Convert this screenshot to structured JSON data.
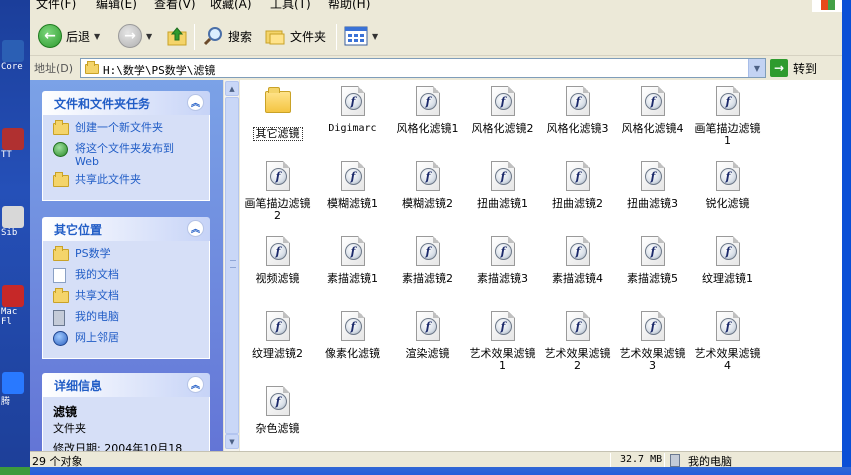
{
  "desktop": {
    "icons": [
      {
        "label": "Core"
      },
      {
        "label": "TT"
      },
      {
        "label": "Sib"
      },
      {
        "label": "Mac"
      },
      {
        "label": "Fl"
      },
      {
        "label": "腾"
      }
    ]
  },
  "menubar": {
    "items": [
      "文件(F)",
      "编辑(E)",
      "查看(V)",
      "收藏(A)",
      "工具(T)",
      "帮助(H)"
    ]
  },
  "toolbar": {
    "back_label": "后退",
    "search_label": "搜索",
    "folders_label": "文件夹"
  },
  "address": {
    "label": "地址(D)",
    "path": "H:\\数学\\PS数学\\滤镜",
    "go_label": "转到"
  },
  "taskpane": {
    "file_tasks": {
      "title": "文件和文件夹任务",
      "items": [
        "创建一个新文件夹",
        "将这个文件夹发布到 Web",
        "共享此文件夹"
      ]
    },
    "other_places": {
      "title": "其它位置",
      "items": [
        "PS数学",
        "我的文档",
        "共享文档",
        "我的电脑",
        "网上邻居"
      ]
    },
    "details": {
      "title": "详细信息",
      "name": "滤镜",
      "type": "文件夹",
      "modified": "修改日期: 2004年10月18"
    }
  },
  "files": [
    {
      "name": "其它滤镜",
      "type": "folder"
    },
    {
      "name": "Digimarc",
      "type": "swf"
    },
    {
      "name": "风格化滤镜1",
      "type": "swf"
    },
    {
      "name": "风格化滤镜2",
      "type": "swf"
    },
    {
      "name": "风格化滤镜3",
      "type": "swf"
    },
    {
      "name": "风格化滤镜4",
      "type": "swf"
    },
    {
      "name": "画笔描边滤镜1",
      "type": "swf"
    },
    {
      "name": "画笔描边滤镜2",
      "type": "swf"
    },
    {
      "name": "模糊滤镜1",
      "type": "swf"
    },
    {
      "name": "模糊滤镜2",
      "type": "swf"
    },
    {
      "name": "扭曲滤镜1",
      "type": "swf"
    },
    {
      "name": "扭曲滤镜2",
      "type": "swf"
    },
    {
      "name": "扭曲滤镜3",
      "type": "swf"
    },
    {
      "name": "锐化滤镜",
      "type": "swf"
    },
    {
      "name": "视频滤镜",
      "type": "swf"
    },
    {
      "name": "素描滤镜1",
      "type": "swf"
    },
    {
      "name": "素描滤镜2",
      "type": "swf"
    },
    {
      "name": "素描滤镜3",
      "type": "swf"
    },
    {
      "name": "素描滤镜4",
      "type": "swf"
    },
    {
      "name": "素描滤镜5",
      "type": "swf"
    },
    {
      "name": "纹理滤镜1",
      "type": "swf"
    },
    {
      "name": "纹理滤镜2",
      "type": "swf"
    },
    {
      "name": "像素化滤镜",
      "type": "swf"
    },
    {
      "name": "渲染滤镜",
      "type": "swf"
    },
    {
      "name": "艺术效果滤镜1",
      "type": "swf"
    },
    {
      "name": "艺术效果滤镜2",
      "type": "swf"
    },
    {
      "name": "艺术效果滤镜3",
      "type": "swf"
    },
    {
      "name": "艺术效果滤镜4",
      "type": "swf"
    },
    {
      "name": "杂色滤镜",
      "type": "swf"
    }
  ],
  "status": {
    "count": "29 个对象",
    "size": "32.7 MB",
    "location": "我的电脑"
  }
}
